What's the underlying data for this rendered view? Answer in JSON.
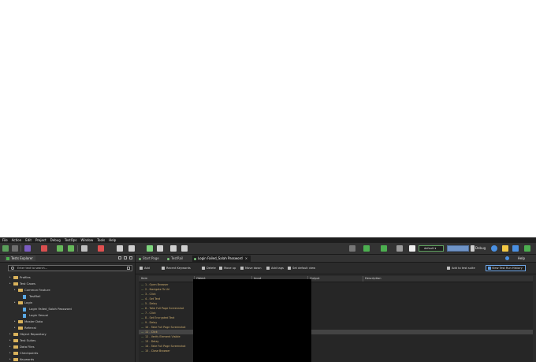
{
  "menu": [
    "File",
    "Action",
    "Edit",
    "Project",
    "Debug",
    "TestOps",
    "Window",
    "Tools",
    "Help"
  ],
  "toolbar": {
    "profile": "default",
    "debug_label": "Debug"
  },
  "explorer": {
    "tab_title": "Tests Explorer",
    "search_placeholder": "Enter text to search...",
    "tree": [
      {
        "label": "Profiles",
        "depth": 1,
        "type": "folder"
      },
      {
        "label": "Test Cases",
        "depth": 1,
        "type": "folder"
      },
      {
        "label": "Common Feature",
        "depth": 2,
        "type": "folder"
      },
      {
        "label": "TestRail",
        "depth": 3,
        "type": "file"
      },
      {
        "label": "Login",
        "depth": 2,
        "type": "folder"
      },
      {
        "label": "Login Failed_Salah Password",
        "depth": 3,
        "type": "file"
      },
      {
        "label": "Login Sesuai",
        "depth": 3,
        "type": "file"
      },
      {
        "label": "Master Data",
        "depth": 2,
        "type": "folder"
      },
      {
        "label": "Referral",
        "depth": 2,
        "type": "folder"
      },
      {
        "label": "Object Repository",
        "depth": 1,
        "type": "folder"
      },
      {
        "label": "Test Suites",
        "depth": 1,
        "type": "folder"
      },
      {
        "label": "Data Files",
        "depth": 1,
        "type": "folder"
      },
      {
        "label": "Checkpoints",
        "depth": 1,
        "type": "folder"
      },
      {
        "label": "Keywords",
        "depth": 1,
        "type": "folder"
      }
    ]
  },
  "editor": {
    "tabs": [
      {
        "label": "Start Page",
        "active": false
      },
      {
        "label": "TestRail",
        "active": false
      },
      {
        "label": "Login Failed_Salah Password",
        "active": true
      }
    ],
    "help_label": "Help",
    "commands": {
      "add": "Add",
      "recent": "Recent Keywords",
      "delete": "Delete",
      "move_up": "Move up",
      "move_down": "Move down",
      "add_tags": "Add tags",
      "set_default_view": "Set default view",
      "add_to_test_suite": "Add to test suite",
      "view_history": "View Test Run History"
    },
    "columns": [
      "Item",
      "Object",
      "Input",
      "Output",
      "Description"
    ],
    "steps": [
      "1 - Open Browser",
      "2 - Navigate To Url",
      "3 - Click",
      "4 - Set Text",
      "5 - Delay",
      "6 - Take Full Page Screenshot",
      "7 - Click",
      "8 - Set Encrypted Text",
      "9 - Delay",
      "10 - Take Full Page Screenshot",
      "11 - Click",
      "12 - Verify Element Visible",
      "13 - Delay",
      "14 - Take Full Page Screenshot",
      "15 - Close Browser"
    ],
    "selected_step": 10
  }
}
